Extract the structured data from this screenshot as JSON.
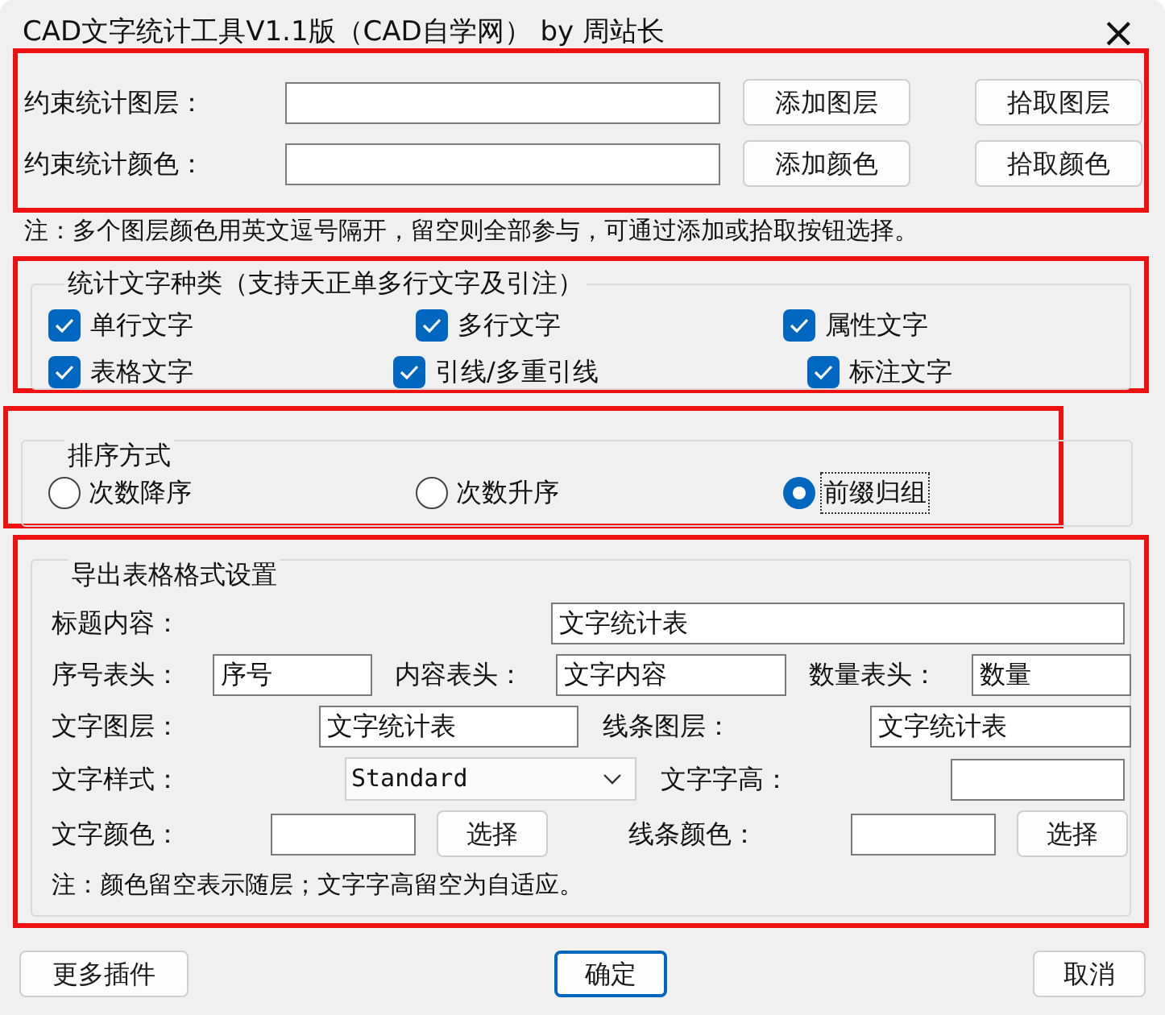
{
  "window": {
    "title": "CAD文字统计工具V1.1版（CAD自学网） by 周站长",
    "close": "×"
  },
  "filter": {
    "rows": [
      {
        "label": "约束统计图层：",
        "buttons": [
          "添加图层",
          "拾取图层"
        ]
      },
      {
        "label": "约束统计颜色：",
        "buttons": [
          "添加颜色",
          "拾取颜色"
        ]
      }
    ],
    "note": "注：多个图层颜色用英文逗号隔开，留空则全部参与，可通过添加或拾取按钮选择。"
  },
  "text_types": {
    "title": "统计文字种类（支持天正单多行文字及引注）",
    "rows": [
      [
        {
          "label": "单行文字",
          "checked": true
        },
        {
          "label": "多行文字",
          "checked": true
        },
        {
          "label": "属性文字",
          "checked": true
        }
      ],
      [
        {
          "label": "表格文字",
          "checked": true
        },
        {
          "label": "引线/多重引线",
          "checked": true
        },
        {
          "label": "标注文字",
          "checked": true
        }
      ]
    ]
  },
  "sort": {
    "title": "排序方式",
    "options": [
      {
        "label": "次数降序",
        "selected": false
      },
      {
        "label": "次数升序",
        "selected": false
      },
      {
        "label": "前缀归组",
        "selected": true
      }
    ]
  },
  "export": {
    "title": "导出表格格式设置",
    "title_content": {
      "label": "标题内容：",
      "value": "文字统计表"
    },
    "headers": [
      {
        "label": "序号表头：",
        "value": "序号"
      },
      {
        "label": "内容表头：",
        "value": "文字内容"
      },
      {
        "label": "数量表头：",
        "value": "数量"
      }
    ],
    "layers": [
      {
        "label": "文字图层：",
        "value": "文字统计表"
      },
      {
        "label": "线条图层：",
        "value": "文字统计表"
      }
    ],
    "style": {
      "label": "文字样式：",
      "value": "Standard"
    },
    "height": {
      "label": "文字字高："
    },
    "colors": [
      {
        "label": "文字颜色：",
        "button": "选择"
      },
      {
        "label": "线条颜色：",
        "button": "选择"
      }
    ],
    "note": "注：颜色留空表示随层；文字字高留空为自适应。"
  },
  "footer": [
    {
      "label": "更多插件",
      "focused": false
    },
    {
      "label": "确定",
      "focused": true
    },
    {
      "label": "取消",
      "focused": false
    }
  ]
}
